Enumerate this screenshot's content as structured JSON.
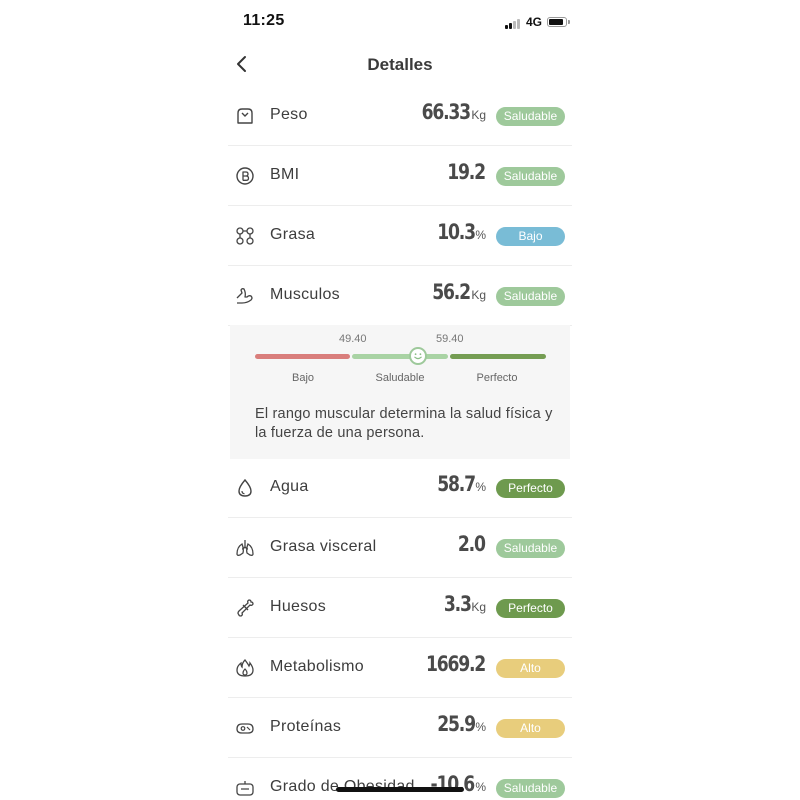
{
  "status_bar": {
    "time": "11:25",
    "network": "4G"
  },
  "header": {
    "title": "Detalles"
  },
  "colors": {
    "saludable": "#9ec99b",
    "bajo": "#79bcd6",
    "perfecto": "#6e9a4e",
    "alto": "#e8cd7c",
    "range_low": "#d97e7c",
    "range_mid": "#a9d3a4",
    "range_high": "#759d53"
  },
  "metrics": [
    {
      "icon": "weight-icon",
      "label": "Peso",
      "value": "66.33",
      "unit": "Kg",
      "status": "Saludable",
      "status_key": "saludable"
    },
    {
      "icon": "bmi-icon",
      "label": "BMI",
      "value": "19.2",
      "unit": "",
      "status": "Saludable",
      "status_key": "saludable"
    },
    {
      "icon": "fat-icon",
      "label": "Grasa",
      "value": "10.3",
      "unit": "%",
      "status": "Bajo",
      "status_key": "bajo"
    },
    {
      "icon": "muscle-icon",
      "label": "Musculos",
      "value": "56.2",
      "unit": "Kg",
      "status": "Saludable",
      "status_key": "saludable"
    },
    {
      "icon": "water-drop-icon",
      "label": "Agua",
      "value": "58.7",
      "unit": "%",
      "status": "Perfecto",
      "status_key": "perfecto"
    },
    {
      "icon": "lungs-icon",
      "label": "Grasa visceral",
      "value": "2.0",
      "unit": "",
      "status": "Saludable",
      "status_key": "saludable"
    },
    {
      "icon": "bone-icon",
      "label": "Huesos",
      "value": "3.3",
      "unit": "Kg",
      "status": "Perfecto",
      "status_key": "perfecto"
    },
    {
      "icon": "flame-icon",
      "label": "Metabolismo",
      "value": "1669.2",
      "unit": "",
      "status": "Alto",
      "status_key": "alto"
    },
    {
      "icon": "protein-icon",
      "label": "Proteínas",
      "value": "25.9",
      "unit": "%",
      "status": "Alto",
      "status_key": "alto"
    },
    {
      "icon": "obesity-scale-icon",
      "label": "Grado de Obesidad",
      "value": "-10.6",
      "unit": "%",
      "status": "Saludable",
      "status_key": "saludable"
    }
  ],
  "muscle_detail": {
    "tick_low": "49.40",
    "tick_high": "59.40",
    "segments": [
      "Bajo",
      "Saludable",
      "Perfecto"
    ],
    "indicator_icon": "smiley-face-icon",
    "description": "El rango muscular determina la salud física y la fuerza de una persona."
  }
}
